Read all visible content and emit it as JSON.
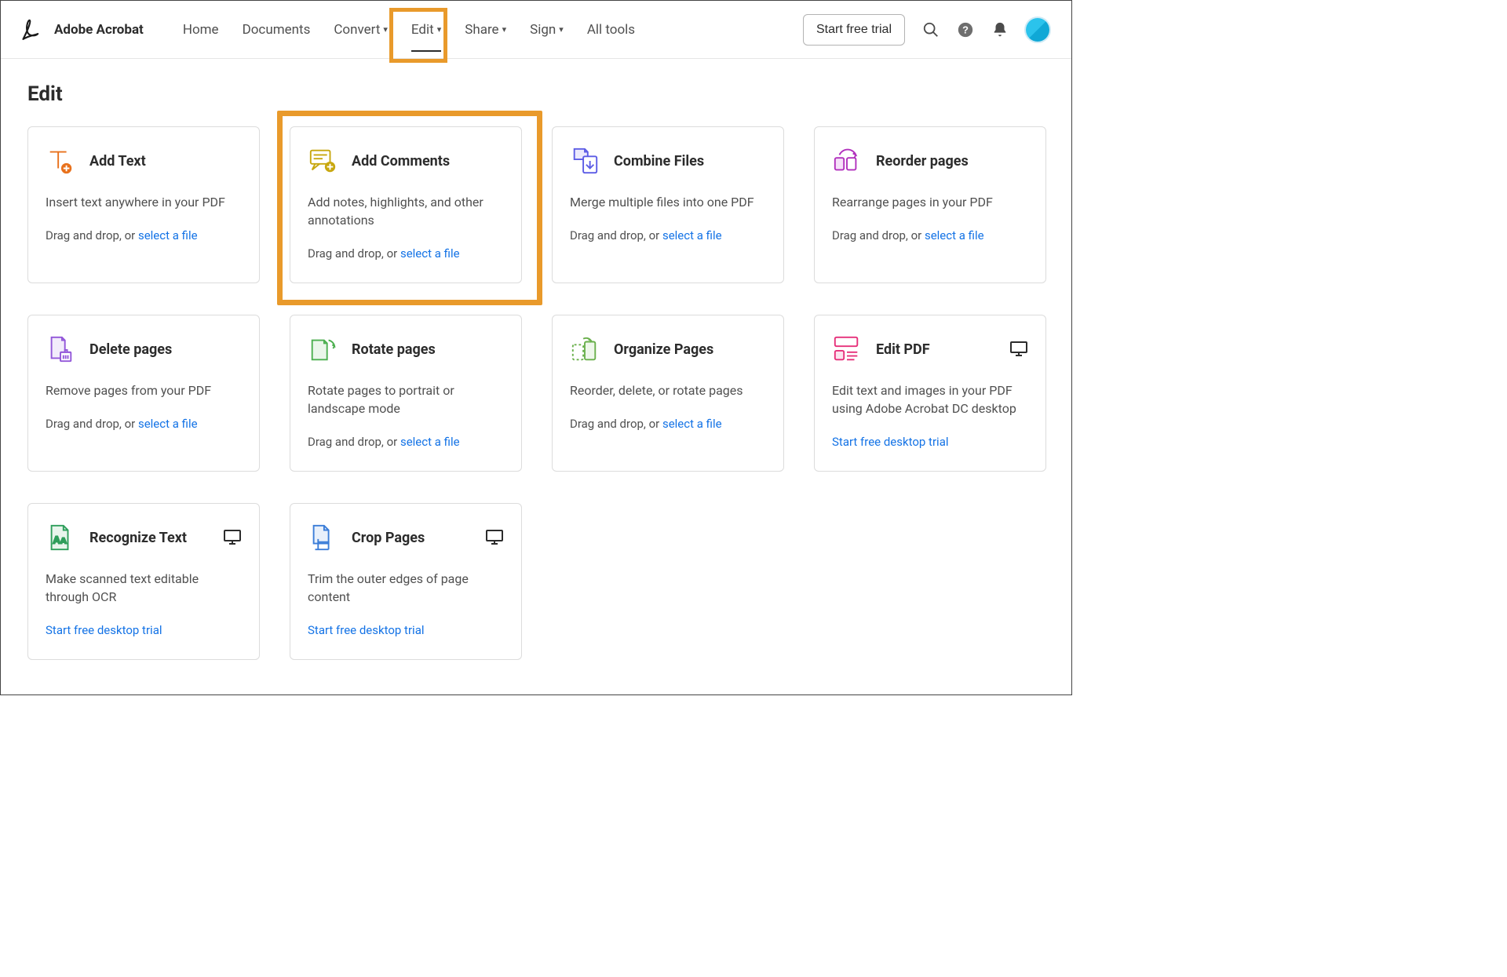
{
  "header": {
    "app_name": "Adobe Acrobat",
    "nav": [
      {
        "label": "Home",
        "has_chevron": false
      },
      {
        "label": "Documents",
        "has_chevron": false
      },
      {
        "label": "Convert",
        "has_chevron": true
      },
      {
        "label": "Edit",
        "has_chevron": true,
        "active": true
      },
      {
        "label": "Share",
        "has_chevron": true
      },
      {
        "label": "Sign",
        "has_chevron": true
      },
      {
        "label": "All tools",
        "has_chevron": false
      }
    ],
    "cta_label": "Start free trial"
  },
  "page": {
    "title": "Edit"
  },
  "cards": [
    {
      "id": "add-text",
      "title": "Add Text",
      "desc": "Insert text anywhere in your PDF",
      "foot_prefix": "Drag and drop, or ",
      "foot_link": "select a file",
      "icon": "add-text-icon"
    },
    {
      "id": "add-comments",
      "title": "Add Comments",
      "desc": "Add notes, highlights, and other annotations",
      "foot_prefix": "Drag and drop, or ",
      "foot_link": "select a file",
      "icon": "add-comments-icon"
    },
    {
      "id": "combine-files",
      "title": "Combine Files",
      "desc": "Merge multiple files into one PDF",
      "foot_prefix": "Drag and drop, or ",
      "foot_link": "select a file",
      "icon": "combine-files-icon"
    },
    {
      "id": "reorder-pages",
      "title": "Reorder pages",
      "desc": "Rearrange pages in your PDF",
      "foot_prefix": "Drag and drop, or ",
      "foot_link": "select a file",
      "icon": "reorder-pages-icon"
    },
    {
      "id": "delete-pages",
      "title": "Delete pages",
      "desc": "Remove pages from your PDF",
      "foot_prefix": "Drag and drop, or ",
      "foot_link": "select a file",
      "icon": "delete-pages-icon"
    },
    {
      "id": "rotate-pages",
      "title": "Rotate pages",
      "desc": "Rotate pages to portrait or landscape mode",
      "foot_prefix": "Drag and drop, or ",
      "foot_link": "select a file",
      "icon": "rotate-pages-icon"
    },
    {
      "id": "organize-pages",
      "title": "Organize Pages",
      "desc": "Reorder, delete, or rotate pages",
      "foot_prefix": "Drag and drop, or ",
      "foot_link": "select a file",
      "icon": "organize-pages-icon"
    },
    {
      "id": "edit-pdf",
      "title": "Edit PDF",
      "desc": "Edit text and images in your PDF using Adobe Acrobat DC desktop",
      "link_only": "Start free desktop trial",
      "icon": "edit-pdf-icon",
      "desktop": true
    },
    {
      "id": "recognize-text",
      "title": "Recognize Text",
      "desc": "Make scanned text editable through OCR",
      "link_only": "Start free desktop trial",
      "icon": "recognize-text-icon",
      "desktop": true
    },
    {
      "id": "crop-pages",
      "title": "Crop Pages",
      "desc": "Trim the outer edges of page content",
      "link_only": "Start free desktop trial",
      "icon": "crop-pages-icon",
      "desktop": true
    }
  ],
  "highlights": {
    "nav_item": "Edit",
    "card_id": "add-comments",
    "color": "#e99a2b"
  }
}
